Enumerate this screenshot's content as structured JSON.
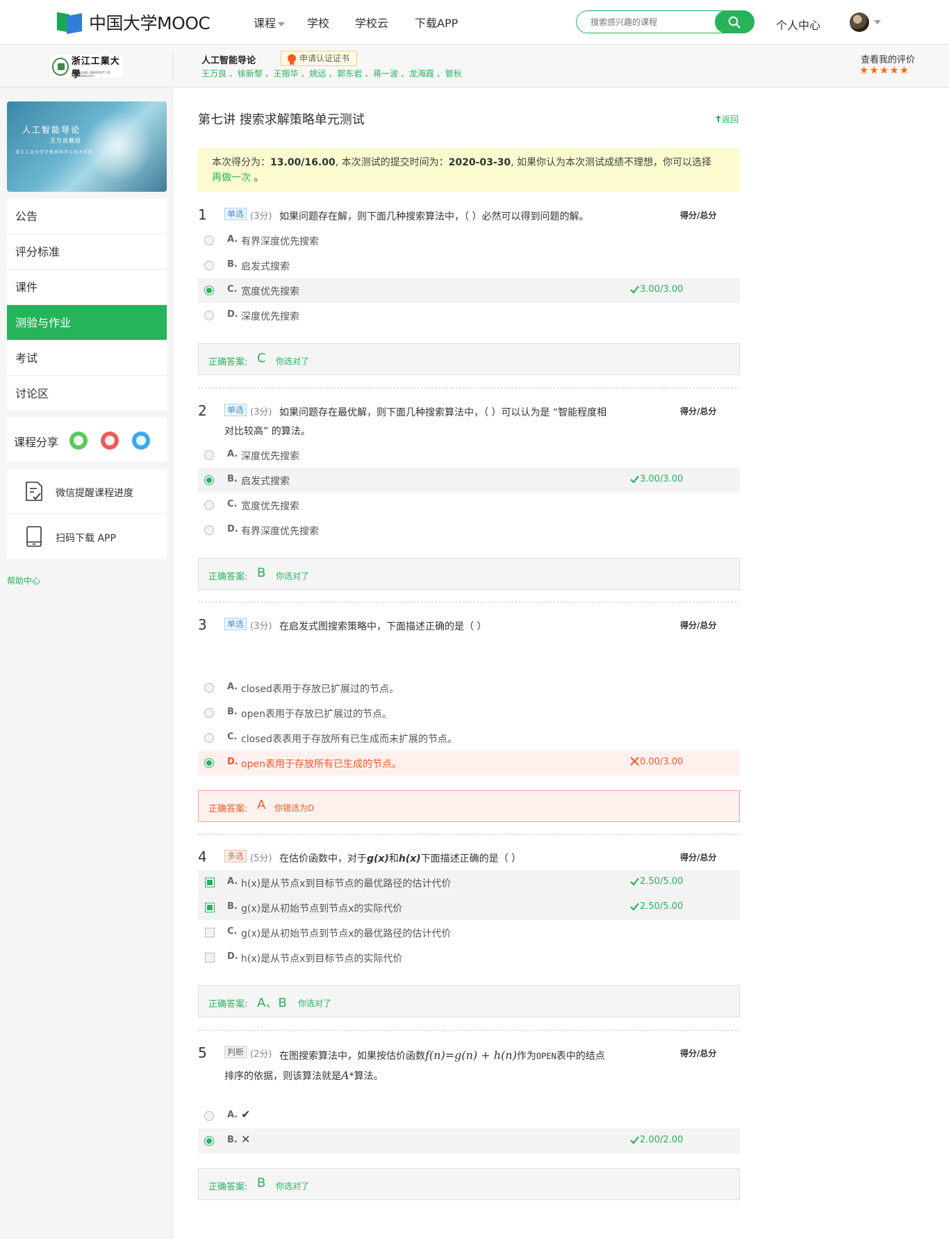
{
  "header": {
    "logo_text": "中国大学MOOC",
    "nav": [
      "课程",
      "学校",
      "学校云",
      "下载APP"
    ],
    "search_placeholder": "搜索感兴趣的课程",
    "user_center": "个人中心"
  },
  "course": {
    "school_name": "浙江工業大學",
    "school_sub": "ZHEJIANG UNIVERSITY OF TECHNOLOGY",
    "title": "人工智能导论",
    "cert_label": "申请认证证书",
    "teachers": "王万良 、徐新黎 、王振华 、姚远 、郭东岩 、蒋一波 、龙海霞 、管秋",
    "review_label": "查看我的评价",
    "stars": "★★★★★"
  },
  "sidebar": {
    "banner_title": "人工智能导论",
    "banner_sub": "王万良教授",
    "banner_sub2": "浙江工业大学计算机科学与技术学院",
    "menu": [
      "公告",
      "评分标准",
      "课件",
      "测验与作业",
      "考试",
      "讨论区"
    ],
    "share_label": "课程分享",
    "tool_wechat": "微信提醒课程进度",
    "tool_app": "扫码下载 APP",
    "help": "帮助中心"
  },
  "main": {
    "title": "第七讲 搜索求解策略单元测试",
    "back": "返回",
    "notice": {
      "p1": "本次得分为：",
      "score": "13.00/16.00",
      "p2": ", 本次测试的提交时间为：",
      "date": "2020-03-30",
      "p3": ", 如果你认为本次测试成绩不理想，你可以选择",
      "redo": "再做一次",
      "p4": " 。"
    },
    "score_header": "得分/总分",
    "answer_label": "正确答案:",
    "questions": [
      {
        "num": "1",
        "type": "单选",
        "points": "(3分)",
        "text": "如果问题存在解，则下面几种搜索算法中，（ ）必然可以得到问题的解。",
        "options": [
          {
            "key": "A.",
            "text": "有界深度优先搜索",
            "score": ""
          },
          {
            "key": "B.",
            "text": "启发式搜索",
            "score": ""
          },
          {
            "key": "C.",
            "text": "宽度优先搜索",
            "score": "3.00/3.00"
          },
          {
            "key": "D.",
            "text": "深度优先搜索",
            "score": ""
          }
        ],
        "answer": "C",
        "note": "你选对了"
      },
      {
        "num": "2",
        "type": "单选",
        "points": "(3分)",
        "text": "如果问题存在最优解，则下面几种搜索算法中，（ ）可以认为是 “智能程度相对比较高” 的算法。",
        "options": [
          {
            "key": "A.",
            "text": "深度优先搜索",
            "score": ""
          },
          {
            "key": "B.",
            "text": "启发式搜索",
            "score": "3.00/3.00"
          },
          {
            "key": "C.",
            "text": "宽度优先搜索",
            "score": ""
          },
          {
            "key": "D.",
            "text": "有界深度优先搜索",
            "score": ""
          }
        ],
        "answer": "B",
        "note": "你选对了"
      },
      {
        "num": "3",
        "type": "单选",
        "points": "(3分)",
        "text": "在启发式图搜索策略中，下面描述正确的是（  ）",
        "options": [
          {
            "key": "A.",
            "text": "closed表用于存放已扩展过的节点。",
            "score": ""
          },
          {
            "key": "B.",
            "text": "open表用于存放已扩展过的节点。",
            "score": ""
          },
          {
            "key": "C.",
            "text": "closed表表用于存放所有已生成而未扩展的节点。",
            "score": ""
          },
          {
            "key": "D.",
            "text": "open表用于存放所有已生成的节点。",
            "score": "0.00/3.00"
          }
        ],
        "answer": "A",
        "note": "你错选为D"
      },
      {
        "num": "4",
        "type": "多选",
        "points": "(5分)",
        "text_pre": "在估价函数中，对于",
        "g": "g(x)",
        "and": "和",
        "h": "h(x)",
        "text_post": "下面描述正确的是（        ）",
        "options": [
          {
            "key": "A.",
            "text": "h(x)是从节点x到目标节点的最优路径的估计代价",
            "score": "2.50/5.00"
          },
          {
            "key": "B.",
            "text": "g(x)是从初始节点到节点x的实际代价",
            "score": "2.50/5.00"
          },
          {
            "key": "C.",
            "text": "g(x)是从初始节点到节点x的最优路径的估计代价",
            "score": ""
          },
          {
            "key": "D.",
            "text": "h(x)是从节点x到目标节点的实际代价",
            "score": ""
          }
        ],
        "answer": "A、B",
        "note": "你选对了"
      },
      {
        "num": "5",
        "type": "判断",
        "points": "(2分)",
        "text_pre": "在图搜索算法中，如果按估价函数",
        "formula": "f(n)=g(n) + h(n)",
        "text_mid": "作为",
        "open_word": "OPEN",
        "text_mid2": "表中的结点排序的依据，则该算法就是",
        "astar": "A",
        "text_post": "*算法。",
        "options": [
          {
            "key": "A.",
            "symbol": "✔",
            "score": ""
          },
          {
            "key": "B.",
            "symbol": "✕",
            "score": "2.00/2.00"
          }
        ],
        "answer": "B",
        "note": "你选对了"
      }
    ]
  },
  "colors": {
    "brand_green": "#26b35a",
    "wrong_red": "#f05a24",
    "notice_bg": "#fbfbcf",
    "star": "#ff6a16"
  }
}
